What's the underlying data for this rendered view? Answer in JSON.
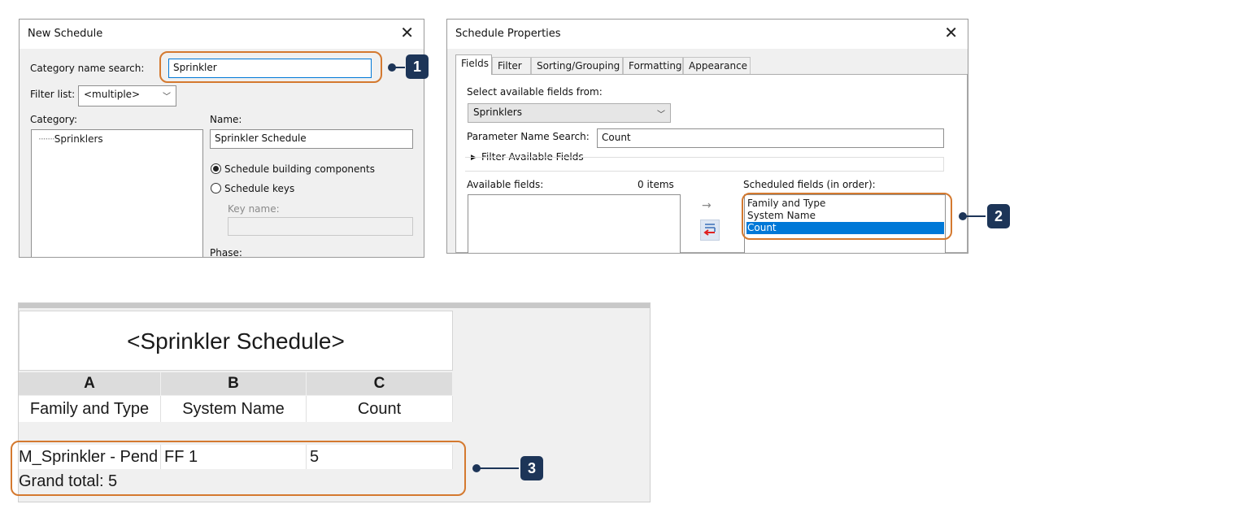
{
  "new_schedule": {
    "title": "New Schedule",
    "close_glyph": "✕",
    "category_search_label": "Category name search:",
    "category_search_value": "Sprinkler",
    "filter_label": "Filter list:",
    "filter_value": "<multiple>",
    "category_label": "Category:",
    "category_items": [
      "Sprinklers"
    ],
    "name_label": "Name:",
    "name_value": "Sprinkler Schedule",
    "radio_building": "Schedule building components",
    "radio_keys": "Schedule keys",
    "key_name_label": "Key name:",
    "phase_label": "Phase:"
  },
  "schedule_properties": {
    "title": "Schedule Properties",
    "close_glyph": "✕",
    "tabs": [
      "Fields",
      "Filter",
      "Sorting/Grouping",
      "Formatting",
      "Appearance"
    ],
    "active_tab": "Fields",
    "select_from_label": "Select available fields from:",
    "select_from_value": "Sprinklers",
    "param_search_label": "Parameter Name Search:",
    "param_search_value": "Count",
    "filter_available_label": "Filter Available Fields",
    "available_label": "Available fields:",
    "available_count": "0 items",
    "scheduled_label": "Scheduled fields (in order):",
    "scheduled_fields": [
      "Family and Type",
      "System Name",
      "Count"
    ],
    "selected_field": "Count",
    "add_arrow": "→"
  },
  "schedule_view": {
    "title": "<Sprinkler Schedule>",
    "column_letters": [
      "A",
      "B",
      "C"
    ],
    "headers": [
      "Family and Type",
      "System Name",
      "Count"
    ],
    "rows": [
      [
        "M_Sprinkler - Pend",
        "FF 1",
        "5"
      ]
    ],
    "grand_total": "Grand total: 5"
  },
  "callouts": [
    "1",
    "2",
    "3"
  ],
  "colors": {
    "highlight_border": "#d4792f",
    "callout_navy": "#1d3558",
    "selection_blue": "#0078d7",
    "remove_arrow_red": "#e02020"
  }
}
